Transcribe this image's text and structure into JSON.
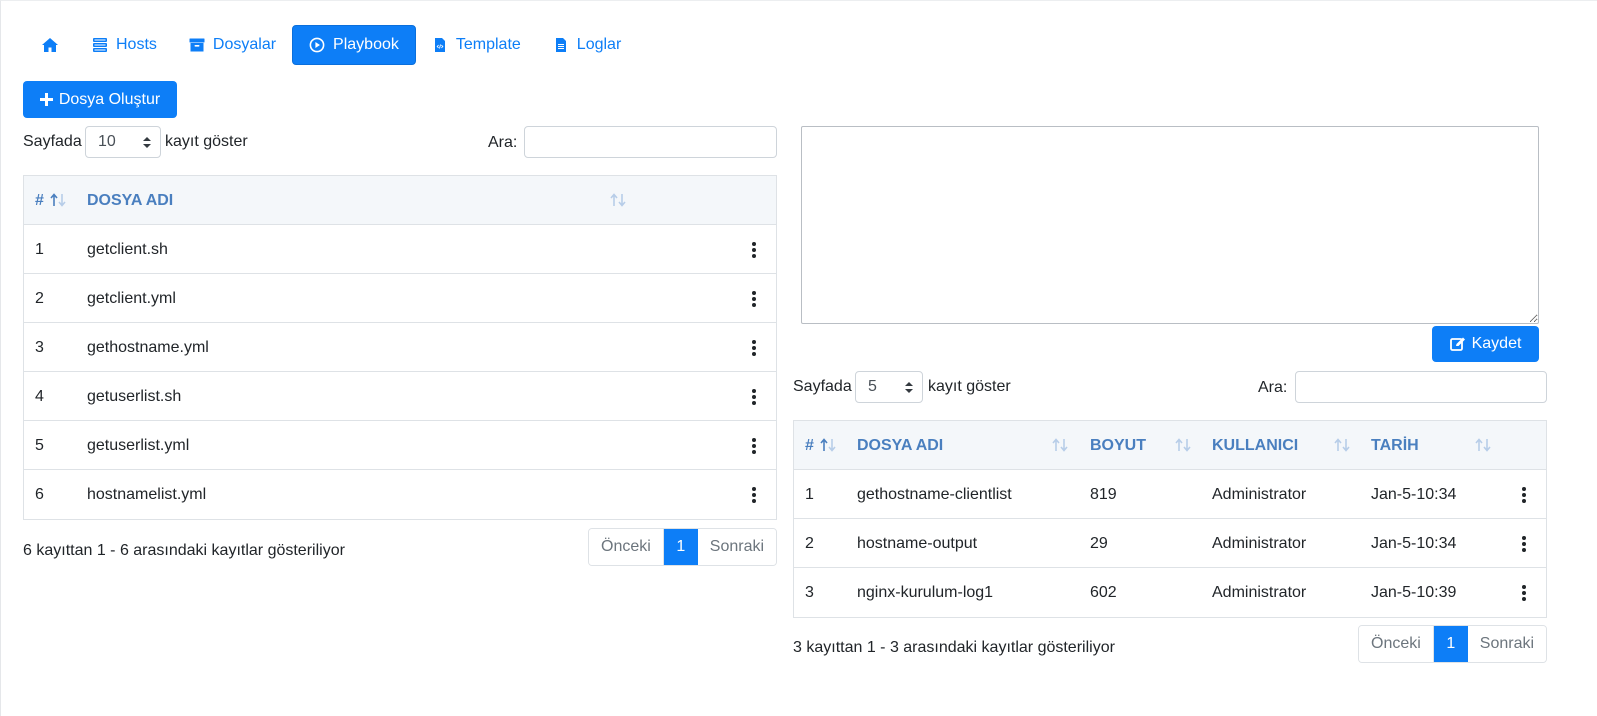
{
  "nav": {
    "tabs": [
      {
        "label": "",
        "icon": "home-icon"
      },
      {
        "label": "Hosts",
        "icon": "server-icon"
      },
      {
        "label": "Dosyalar",
        "icon": "archive-icon"
      },
      {
        "label": "Playbook",
        "icon": "play-circle-icon",
        "active": true
      },
      {
        "label": "Template",
        "icon": "file-code-icon"
      },
      {
        "label": "Loglar",
        "icon": "file-text-icon"
      }
    ]
  },
  "create_button": {
    "label": "Dosya Oluştur"
  },
  "left": {
    "length_prefix": "Sayfada",
    "length_value": "10",
    "length_suffix": "kayıt göster",
    "search_label": "Ara:",
    "search_value": "",
    "columns": [
      "#",
      "DOSYA ADI"
    ],
    "rows": [
      {
        "n": "1",
        "name": "getclient.sh"
      },
      {
        "n": "2",
        "name": "getclient.yml"
      },
      {
        "n": "3",
        "name": "gethostname.yml"
      },
      {
        "n": "4",
        "name": "getuserlist.sh"
      },
      {
        "n": "5",
        "name": "getuserlist.yml"
      },
      {
        "n": "6",
        "name": "hostnamelist.yml"
      }
    ],
    "info": "6 kayıttan 1 - 6 arasındaki kayıtlar gösteriliyor",
    "pager": {
      "prev": "Önceki",
      "current": "1",
      "next": "Sonraki"
    }
  },
  "editor": {
    "content": "",
    "save_label": "Kaydet"
  },
  "right": {
    "length_prefix": "Sayfada",
    "length_value": "5",
    "length_suffix": "kayıt göster",
    "search_label": "Ara:",
    "search_value": "",
    "columns": [
      "#",
      "DOSYA ADI",
      "BOYUT",
      "KULLANICI",
      "TARİH"
    ],
    "rows": [
      {
        "n": "1",
        "name": "gethostname-clientlist",
        "size": "819",
        "user": "Administrator",
        "date": "Jan-5-10:34"
      },
      {
        "n": "2",
        "name": "hostname-output",
        "size": "29",
        "user": "Administrator",
        "date": "Jan-5-10:34"
      },
      {
        "n": "3",
        "name": "nginx-kurulum-log1",
        "size": "602",
        "user": "Administrator",
        "date": "Jan-5-10:39"
      }
    ],
    "info": "3 kayıttan 1 - 3 arasındaki kayıtlar gösteriliyor",
    "pager": {
      "prev": "Önceki",
      "current": "1",
      "next": "Sonraki"
    }
  },
  "colors": {
    "accent": "#0d7ef7",
    "header_text": "#4a7fbf",
    "header_bg": "#f4f7fa",
    "border": "#dee2e6"
  }
}
